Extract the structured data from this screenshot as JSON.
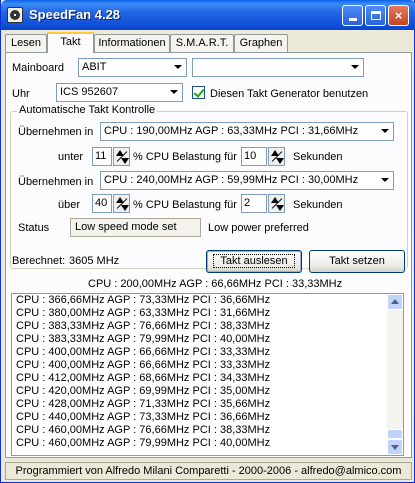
{
  "window": {
    "title": "SpeedFan 4.28",
    "minimize_label": "",
    "maximize_label": "",
    "close_label": "×"
  },
  "tabs": [
    {
      "label": "Lesen"
    },
    {
      "label": "Takt"
    },
    {
      "label": "Informationen"
    },
    {
      "label": "S.M.A.R.T."
    },
    {
      "label": "Graphen"
    }
  ],
  "active_tab": "Takt",
  "mainboard": {
    "label": "Mainboard",
    "vendor_value": "ABIT",
    "model_value": ""
  },
  "uhr": {
    "label": "Uhr",
    "value": "ICS 952607",
    "checkbox_label": "Diesen Takt Generator benutzen",
    "checkbox_checked": true
  },
  "auto": {
    "title": "Automatische Takt Kontrolle",
    "rule1": {
      "label": "Übernehmen in",
      "value": "CPU : 190,00MHz AGP : 63,33MHz PCI : 31,66MHz",
      "cond_label": "unter",
      "percent": "11",
      "cpu_label": "% CPU Belastung für",
      "seconds": "10",
      "seconds_label": "Sekunden"
    },
    "rule2": {
      "label": "Übernehmen in",
      "value": "CPU : 240,00MHz AGP : 59,99MHz PCI : 30,00MHz",
      "cond_label": "über",
      "percent": "40",
      "cpu_label": "% CPU Belastung für",
      "seconds": "2",
      "seconds_label": "Sekunden"
    },
    "status_label": "Status",
    "status_value": "Low speed mode set",
    "power_text": "Low power preferred"
  },
  "computed": {
    "label": "Berechnet:",
    "value": "3605 MHz"
  },
  "buttons": {
    "read": "Takt auslesen",
    "set": "Takt setzen"
  },
  "current_clock": "CPU : 200,00MHz AGP : 66,66MHz PCI : 33,33MHz",
  "clock_list": [
    "CPU : 366,66MHz AGP : 73,33MHz PCI : 36,66MHz",
    "CPU : 380,00MHz AGP : 63,33MHz PCI : 31,66MHz",
    "CPU : 383,33MHz AGP : 76,66MHz PCI : 38,33MHz",
    "CPU : 383,33MHz AGP : 79,99MHz PCI : 40,00MHz",
    "CPU : 400,00MHz AGP : 66,66MHz PCI : 33,33MHz",
    "CPU : 400,00MHz AGP : 66,66MHz PCI : 33,33MHz",
    "CPU : 412,00MHz AGP : 68,66MHz PCI : 34,33MHz",
    "CPU : 420,00MHz AGP : 69,99MHz PCI : 35,00MHz",
    "CPU : 428,00MHz AGP : 71,33MHz PCI : 35,66MHz",
    "CPU : 440,00MHz AGP : 73,33MHz PCI : 36,66MHz",
    "CPU : 460,00MHz AGP : 76,66MHz PCI : 38,33MHz",
    "CPU : 460,00MHz AGP : 79,99MHz PCI : 40,00MHz"
  ],
  "footer": "Programmiert von Alfredo Milani Comparetti - 2000-2006 - alfredo@almico.com"
}
